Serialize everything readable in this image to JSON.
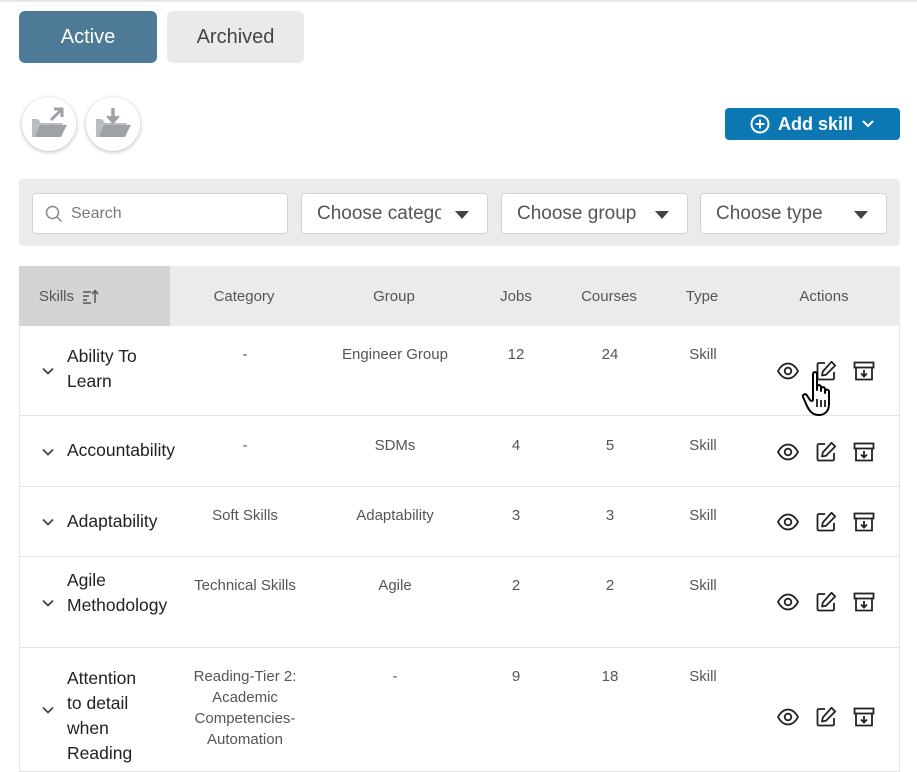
{
  "tabs": [
    {
      "label": "Active"
    },
    {
      "label": "Archived"
    }
  ],
  "icons": {
    "upload": "folder-upload-icon",
    "download": "folder-download-icon",
    "plus": "plus-circle-icon",
    "search": "search-icon",
    "caret": "caret-down-icon",
    "sort": "sort-icon",
    "chevron": "chevron-down-icon",
    "view": "eye-icon",
    "edit": "edit-icon",
    "archive": "archive-icon"
  },
  "add_skill": {
    "label": "Add skill"
  },
  "filters": {
    "search_placeholder": "Search",
    "category": "Choose category",
    "group": "Choose group",
    "type": "Choose type"
  },
  "table": {
    "headers": [
      "Skills",
      "Category",
      "Group",
      "Jobs",
      "Courses",
      "Type",
      "Actions"
    ],
    "rows": [
      {
        "skill": [
          "Ability To",
          "Learn"
        ],
        "category": [
          "-"
        ],
        "group": [
          "Engineer Group"
        ],
        "jobs": "12",
        "courses": "24",
        "type": "Skill"
      },
      {
        "skill": [
          "Accountability"
        ],
        "category": [
          "-"
        ],
        "group": [
          "SDMs"
        ],
        "jobs": "4",
        "courses": "5",
        "type": "Skill"
      },
      {
        "skill": [
          "Adaptability"
        ],
        "category": [
          "Soft Skills"
        ],
        "group": [
          "Adaptability"
        ],
        "jobs": "3",
        "courses": "3",
        "type": "Skill"
      },
      {
        "skill": [
          "Agile",
          "Methodology"
        ],
        "category": [
          "Technical Skills"
        ],
        "group": [
          "Agile"
        ],
        "jobs": "2",
        "courses": "2",
        "type": "Skill"
      },
      {
        "skill": [
          "Attention",
          "to detail",
          "when",
          "Reading"
        ],
        "category": [
          "Reading-Tier 2:",
          "Academic",
          "Competencies-",
          "Automation"
        ],
        "group": [
          "-"
        ],
        "jobs": "9",
        "courses": "18",
        "type": "Skill"
      }
    ]
  },
  "colors": {
    "active_tab": "#4d7a96",
    "add_button": "#0b78b3",
    "header_bg": "#eaebed",
    "sorted_header_bg": "#d3d4d6"
  }
}
